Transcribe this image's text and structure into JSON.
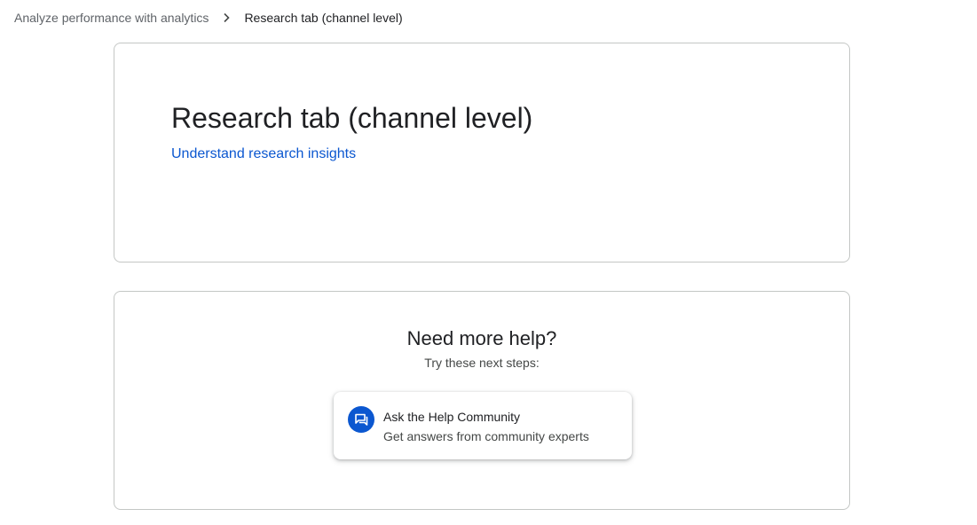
{
  "breadcrumb": {
    "parent": "Analyze performance with analytics",
    "separator_icon": "chevron-right-icon",
    "current": "Research tab (channel level)"
  },
  "article": {
    "title": "Research tab (channel level)",
    "link_text": "Understand research insights"
  },
  "help": {
    "title": "Need more help?",
    "subtitle": "Try these next steps:",
    "community": {
      "icon": "forum-icon",
      "title": "Ask the Help Community",
      "description": "Get answers from community experts"
    }
  },
  "colors": {
    "link": "#0b57d0",
    "icon_bg": "#0b57d0",
    "border": "#c4c7c5"
  }
}
